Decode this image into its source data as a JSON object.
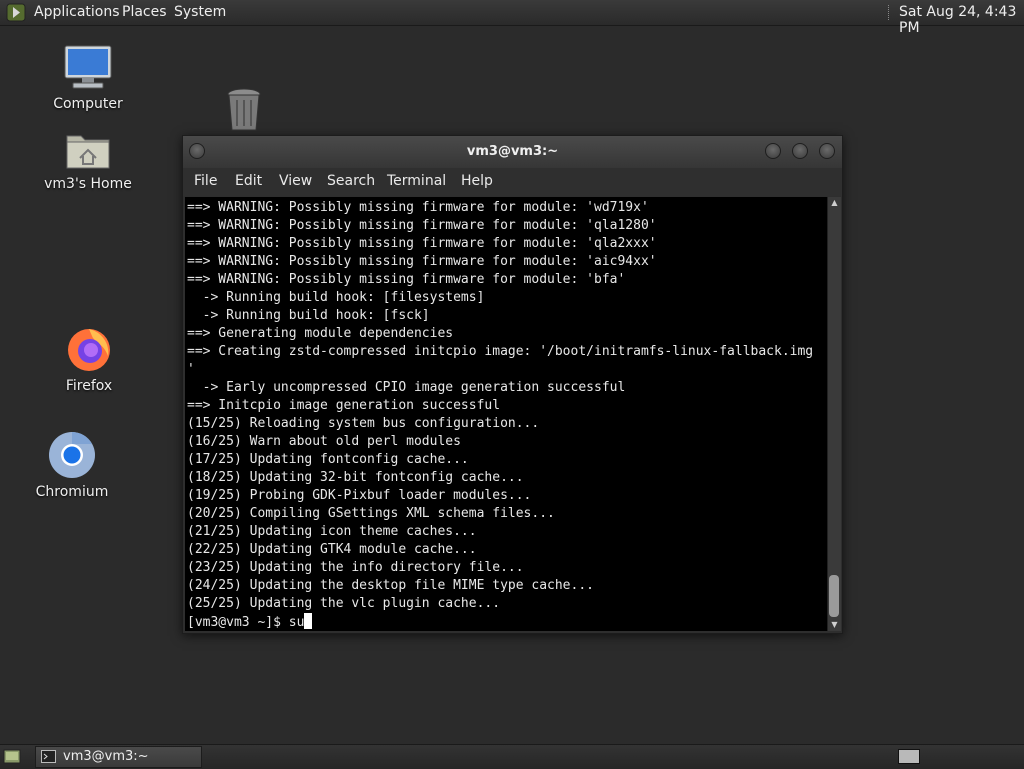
{
  "top_panel": {
    "menus": [
      "Applications",
      "Places",
      "System"
    ],
    "clock": "Sat Aug 24,  4:43 PM"
  },
  "desktop": {
    "icons": [
      {
        "label": "Computer",
        "icon": "computer-icon"
      },
      {
        "label": "vm3's Home",
        "icon": "home-folder-icon"
      },
      {
        "label": "",
        "icon": "trash-icon"
      },
      {
        "label": "Firefox",
        "icon": "firefox-icon"
      },
      {
        "label": "Chromium",
        "icon": "chromium-icon"
      }
    ]
  },
  "terminal": {
    "title": "vm3@vm3:~",
    "menu": [
      "File",
      "Edit",
      "View",
      "Search",
      "Terminal",
      "Help"
    ],
    "lines": [
      "==> WARNING: Possibly missing firmware for module: 'wd719x'",
      "==> WARNING: Possibly missing firmware for module: 'qla1280'",
      "==> WARNING: Possibly missing firmware for module: 'qla2xxx'",
      "==> WARNING: Possibly missing firmware for module: 'aic94xx'",
      "==> WARNING: Possibly missing firmware for module: 'bfa'",
      "  -> Running build hook: [filesystems]",
      "  -> Running build hook: [fsck]",
      "==> Generating module dependencies",
      "==> Creating zstd-compressed initcpio image: '/boot/initramfs-linux-fallback.img",
      "'",
      "  -> Early uncompressed CPIO image generation successful",
      "==> Initcpio image generation successful",
      "(15/25) Reloading system bus configuration...",
      "(16/25) Warn about old perl modules",
      "(17/25) Updating fontconfig cache...",
      "(18/25) Updating 32-bit fontconfig cache...",
      "(19/25) Probing GDK-Pixbuf loader modules...",
      "(20/25) Compiling GSettings XML schema files...",
      "(21/25) Updating icon theme caches...",
      "(22/25) Updating GTK4 module cache...",
      "(23/25) Updating the info directory file...",
      "(24/25) Updating the desktop file MIME type cache...",
      "(25/25) Updating the vlc plugin cache..."
    ],
    "prompt": "[vm3@vm3 ~]$ su"
  },
  "bottom_panel": {
    "task_label": "vm3@vm3:~"
  }
}
